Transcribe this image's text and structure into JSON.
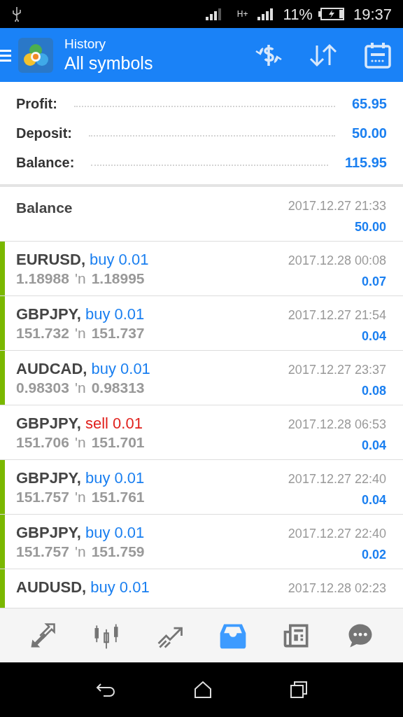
{
  "status_bar": {
    "network": "H+",
    "battery": "11%",
    "time": "19:37"
  },
  "header": {
    "title": "History",
    "subtitle": "All symbols"
  },
  "summary": [
    {
      "label": "Profit:",
      "value": "65.95"
    },
    {
      "label": "Deposit:",
      "value": "50.00"
    },
    {
      "label": "Balance:",
      "value": "115.95"
    }
  ],
  "balance_entry": {
    "label": "Balance",
    "time": "2017.12.27 21:33",
    "amount": "50.00"
  },
  "deals": [
    {
      "symbol": "EURUSD,",
      "action": "buy 0.01",
      "kind": "buy",
      "marked": true,
      "open": "1.18988",
      "arrow": "'n",
      "close": "1.18995",
      "time": "2017.12.28 00:08",
      "profit": "0.07"
    },
    {
      "symbol": "GBPJPY,",
      "action": "buy 0.01",
      "kind": "buy",
      "marked": true,
      "open": "151.732",
      "arrow": "'n",
      "close": "151.737",
      "time": "2017.12.27 21:54",
      "profit": "0.04"
    },
    {
      "symbol": "AUDCAD,",
      "action": "buy 0.01",
      "kind": "buy",
      "marked": true,
      "open": "0.98303",
      "arrow": "'n",
      "close": "0.98313",
      "time": "2017.12.27 23:37",
      "profit": "0.08"
    },
    {
      "symbol": "GBPJPY,",
      "action": "sell 0.01",
      "kind": "sell",
      "marked": false,
      "open": "151.706",
      "arrow": "'n",
      "close": "151.701",
      "time": "2017.12.28 06:53",
      "profit": "0.04"
    },
    {
      "symbol": "GBPJPY,",
      "action": "buy 0.01",
      "kind": "buy",
      "marked": true,
      "open": "151.757",
      "arrow": "'n",
      "close": "151.761",
      "time": "2017.12.27 22:40",
      "profit": "0.04"
    },
    {
      "symbol": "GBPJPY,",
      "action": "buy 0.01",
      "kind": "buy",
      "marked": true,
      "open": "151.757",
      "arrow": "'n",
      "close": "151.759",
      "time": "2017.12.27 22:40",
      "profit": "0.02"
    },
    {
      "symbol": "AUDUSD,",
      "action": "buy 0.01",
      "kind": "buy",
      "marked": true,
      "time": "2017.12.28 02:23"
    }
  ],
  "bottom_nav": [
    {
      "kind": "trade",
      "selected": false
    },
    {
      "kind": "chart",
      "selected": false
    },
    {
      "kind": "trend",
      "selected": false
    },
    {
      "kind": "history",
      "selected": true
    },
    {
      "kind": "news",
      "selected": false
    },
    {
      "kind": "chat",
      "selected": false
    }
  ]
}
